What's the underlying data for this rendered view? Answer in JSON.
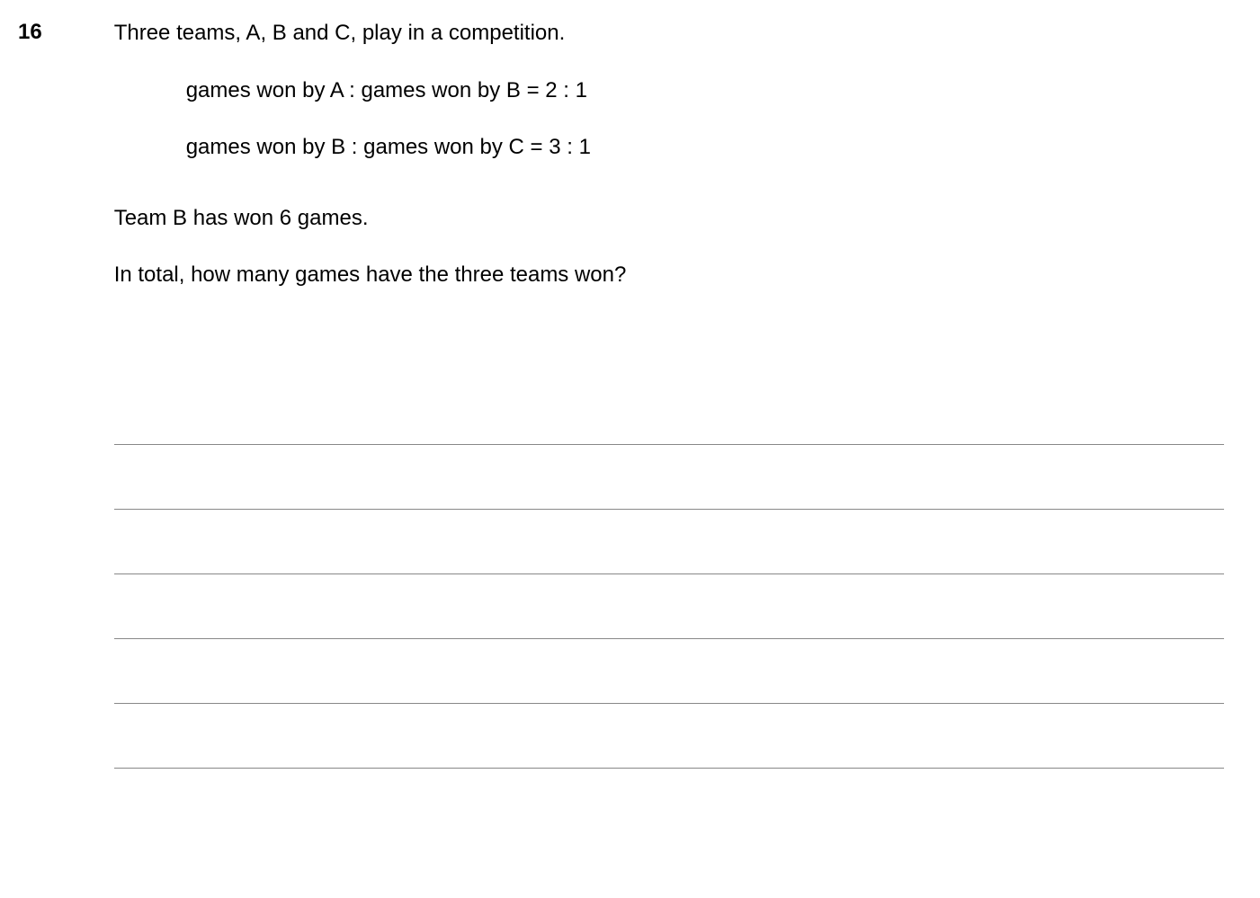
{
  "question": {
    "number": "16",
    "intro": "Three teams, A, B and C, play in a competition.",
    "ratio1": "games won by A : games won by B = 2 : 1",
    "ratio2": "games won by B : games won by C = 3 : 1",
    "statement": "Team B has won 6 games.",
    "final": "In total, how many games have the three teams won?"
  }
}
